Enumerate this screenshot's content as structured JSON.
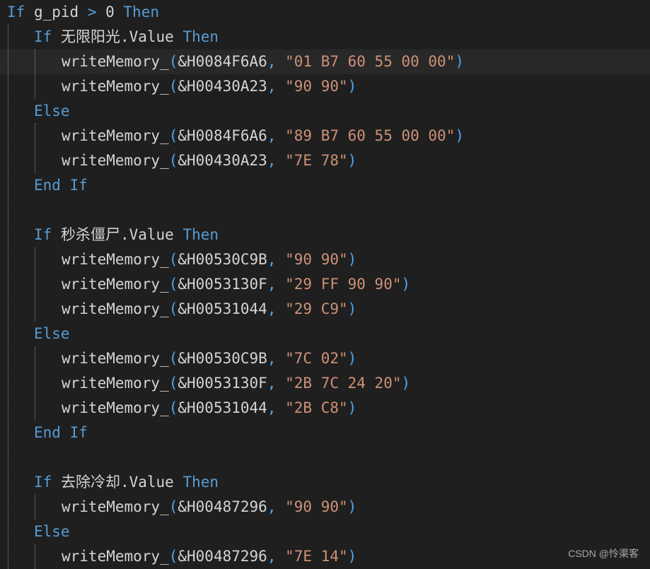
{
  "editor": {
    "lines": [
      {
        "indent": 0,
        "tokens": [
          {
            "t": "kw",
            "v": "If"
          },
          {
            "t": "id",
            "v": " g_pid "
          },
          {
            "t": "kw",
            "v": ">"
          },
          {
            "t": "id",
            "v": " 0 "
          },
          {
            "t": "kw",
            "v": "Then"
          }
        ]
      },
      {
        "indent": 1,
        "tokens": [
          {
            "t": "kw",
            "v": "If"
          },
          {
            "t": "id",
            "v": " 无限阳光.Value "
          },
          {
            "t": "kw",
            "v": "Then"
          }
        ]
      },
      {
        "indent": 2,
        "current": true,
        "tokens": [
          {
            "t": "id",
            "v": "writeMemory_"
          },
          {
            "t": "paren",
            "v": "("
          },
          {
            "t": "id",
            "v": "&H0084F6A6"
          },
          {
            "t": "comma",
            "v": ","
          },
          {
            "t": "id",
            "v": " "
          },
          {
            "t": "str",
            "v": "\"01 B7 60 55 00 00\""
          },
          {
            "t": "paren",
            "v": ")"
          }
        ]
      },
      {
        "indent": 2,
        "tokens": [
          {
            "t": "id",
            "v": "writeMemory_"
          },
          {
            "t": "paren",
            "v": "("
          },
          {
            "t": "id",
            "v": "&H00430A23"
          },
          {
            "t": "comma",
            "v": ","
          },
          {
            "t": "id",
            "v": " "
          },
          {
            "t": "str",
            "v": "\"90 90\""
          },
          {
            "t": "paren",
            "v": ")"
          }
        ]
      },
      {
        "indent": 1,
        "tokens": [
          {
            "t": "kw",
            "v": "Else"
          }
        ]
      },
      {
        "indent": 2,
        "tokens": [
          {
            "t": "id",
            "v": "writeMemory_"
          },
          {
            "t": "paren",
            "v": "("
          },
          {
            "t": "id",
            "v": "&H0084F6A6"
          },
          {
            "t": "comma",
            "v": ","
          },
          {
            "t": "id",
            "v": " "
          },
          {
            "t": "str",
            "v": "\"89 B7 60 55 00 00\""
          },
          {
            "t": "paren",
            "v": ")"
          }
        ]
      },
      {
        "indent": 2,
        "tokens": [
          {
            "t": "id",
            "v": "writeMemory_"
          },
          {
            "t": "paren",
            "v": "("
          },
          {
            "t": "id",
            "v": "&H00430A23"
          },
          {
            "t": "comma",
            "v": ","
          },
          {
            "t": "id",
            "v": " "
          },
          {
            "t": "str",
            "v": "\"7E 78\""
          },
          {
            "t": "paren",
            "v": ")"
          }
        ]
      },
      {
        "indent": 1,
        "tokens": [
          {
            "t": "kw",
            "v": "End If"
          }
        ]
      },
      {
        "indent": 0,
        "tokens": []
      },
      {
        "indent": 1,
        "tokens": [
          {
            "t": "kw",
            "v": "If"
          },
          {
            "t": "id",
            "v": " 秒杀僵尸.Value "
          },
          {
            "t": "kw",
            "v": "Then"
          }
        ]
      },
      {
        "indent": 2,
        "tokens": [
          {
            "t": "id",
            "v": "writeMemory_"
          },
          {
            "t": "paren",
            "v": "("
          },
          {
            "t": "id",
            "v": "&H00530C9B"
          },
          {
            "t": "comma",
            "v": ","
          },
          {
            "t": "id",
            "v": " "
          },
          {
            "t": "str",
            "v": "\"90 90\""
          },
          {
            "t": "paren",
            "v": ")"
          }
        ]
      },
      {
        "indent": 2,
        "tokens": [
          {
            "t": "id",
            "v": "writeMemory_"
          },
          {
            "t": "paren",
            "v": "("
          },
          {
            "t": "id",
            "v": "&H0053130F"
          },
          {
            "t": "comma",
            "v": ","
          },
          {
            "t": "id",
            "v": " "
          },
          {
            "t": "str",
            "v": "\"29 FF 90 90\""
          },
          {
            "t": "paren",
            "v": ")"
          }
        ]
      },
      {
        "indent": 2,
        "tokens": [
          {
            "t": "id",
            "v": "writeMemory_"
          },
          {
            "t": "paren",
            "v": "("
          },
          {
            "t": "id",
            "v": "&H00531044"
          },
          {
            "t": "comma",
            "v": ","
          },
          {
            "t": "id",
            "v": " "
          },
          {
            "t": "str",
            "v": "\"29 C9\""
          },
          {
            "t": "paren",
            "v": ")"
          }
        ]
      },
      {
        "indent": 1,
        "tokens": [
          {
            "t": "kw",
            "v": "Else"
          }
        ]
      },
      {
        "indent": 2,
        "tokens": [
          {
            "t": "id",
            "v": "writeMemory_"
          },
          {
            "t": "paren",
            "v": "("
          },
          {
            "t": "id",
            "v": "&H00530C9B"
          },
          {
            "t": "comma",
            "v": ","
          },
          {
            "t": "id",
            "v": " "
          },
          {
            "t": "str",
            "v": "\"7C 02\""
          },
          {
            "t": "paren",
            "v": ")"
          }
        ]
      },
      {
        "indent": 2,
        "tokens": [
          {
            "t": "id",
            "v": "writeMemory_"
          },
          {
            "t": "paren",
            "v": "("
          },
          {
            "t": "id",
            "v": "&H0053130F"
          },
          {
            "t": "comma",
            "v": ","
          },
          {
            "t": "id",
            "v": " "
          },
          {
            "t": "str",
            "v": "\"2B 7C 24 20\""
          },
          {
            "t": "paren",
            "v": ")"
          }
        ]
      },
      {
        "indent": 2,
        "tokens": [
          {
            "t": "id",
            "v": "writeMemory_"
          },
          {
            "t": "paren",
            "v": "("
          },
          {
            "t": "id",
            "v": "&H00531044"
          },
          {
            "t": "comma",
            "v": ","
          },
          {
            "t": "id",
            "v": " "
          },
          {
            "t": "str",
            "v": "\"2B C8\""
          },
          {
            "t": "paren",
            "v": ")"
          }
        ]
      },
      {
        "indent": 1,
        "tokens": [
          {
            "t": "kw",
            "v": "End If"
          }
        ]
      },
      {
        "indent": 0,
        "tokens": []
      },
      {
        "indent": 1,
        "tokens": [
          {
            "t": "kw",
            "v": "If"
          },
          {
            "t": "id",
            "v": " 去除冷却.Value "
          },
          {
            "t": "kw",
            "v": "Then"
          }
        ]
      },
      {
        "indent": 2,
        "tokens": [
          {
            "t": "id",
            "v": "writeMemory_"
          },
          {
            "t": "paren",
            "v": "("
          },
          {
            "t": "id",
            "v": "&H00487296"
          },
          {
            "t": "comma",
            "v": ","
          },
          {
            "t": "id",
            "v": " "
          },
          {
            "t": "str",
            "v": "\"90 90\""
          },
          {
            "t": "paren",
            "v": ")"
          }
        ]
      },
      {
        "indent": 1,
        "tokens": [
          {
            "t": "kw",
            "v": "Else"
          }
        ]
      },
      {
        "indent": 2,
        "tokens": [
          {
            "t": "id",
            "v": "writeMemory_"
          },
          {
            "t": "paren",
            "v": "("
          },
          {
            "t": "id",
            "v": "&H00487296"
          },
          {
            "t": "comma",
            "v": ","
          },
          {
            "t": "id",
            "v": " "
          },
          {
            "t": "str",
            "v": "\"7E 14\""
          },
          {
            "t": "paren",
            "v": ")"
          }
        ]
      }
    ]
  },
  "watermark": "CSDN @怜渠客",
  "colors": {
    "background": "#1f1f1f",
    "current_line": "#282828",
    "keyword": "#569cd6",
    "identifier": "#d4d4d4",
    "string": "#ce9178",
    "bracket": "#4fa4ef"
  }
}
